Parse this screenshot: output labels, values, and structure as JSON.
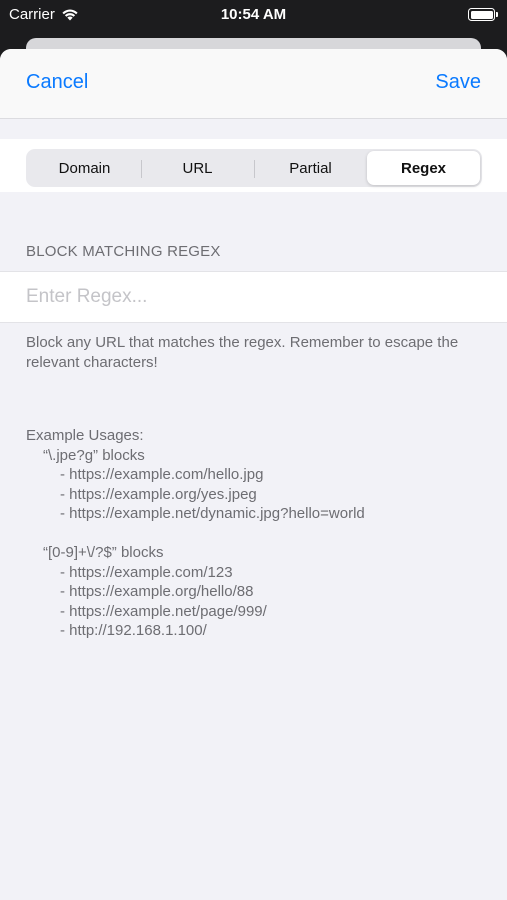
{
  "status_bar": {
    "carrier": "Carrier",
    "time": "10:54 AM"
  },
  "nav": {
    "cancel_label": "Cancel",
    "save_label": "Save",
    "accent_color": "#0a7aff"
  },
  "segments": {
    "items": [
      "Domain",
      "URL",
      "Partial",
      "Regex"
    ],
    "selected": "Regex"
  },
  "section": {
    "header": "BLOCK MATCHING REGEX",
    "input_placeholder": "Enter Regex...",
    "input_value": "",
    "description": "Block any URL that matches the regex. Remember to escape the relevant characters!"
  },
  "examples": {
    "title": "Example Usages:",
    "groups": [
      {
        "pattern": "“\\.jpe?g” blocks",
        "urls": [
          "- https://example.com/hello.jpg",
          "- https://example.org/yes.jpeg",
          "- https://example.net/dynamic.jpg?hello=world"
        ]
      },
      {
        "pattern": "“[0-9]+\\/?$” blocks",
        "urls": [
          "- https://example.com/123",
          "- https://example.org/hello/88",
          "- https://example.net/page/999/",
          "- http://192.168.1.100/"
        ]
      }
    ]
  }
}
